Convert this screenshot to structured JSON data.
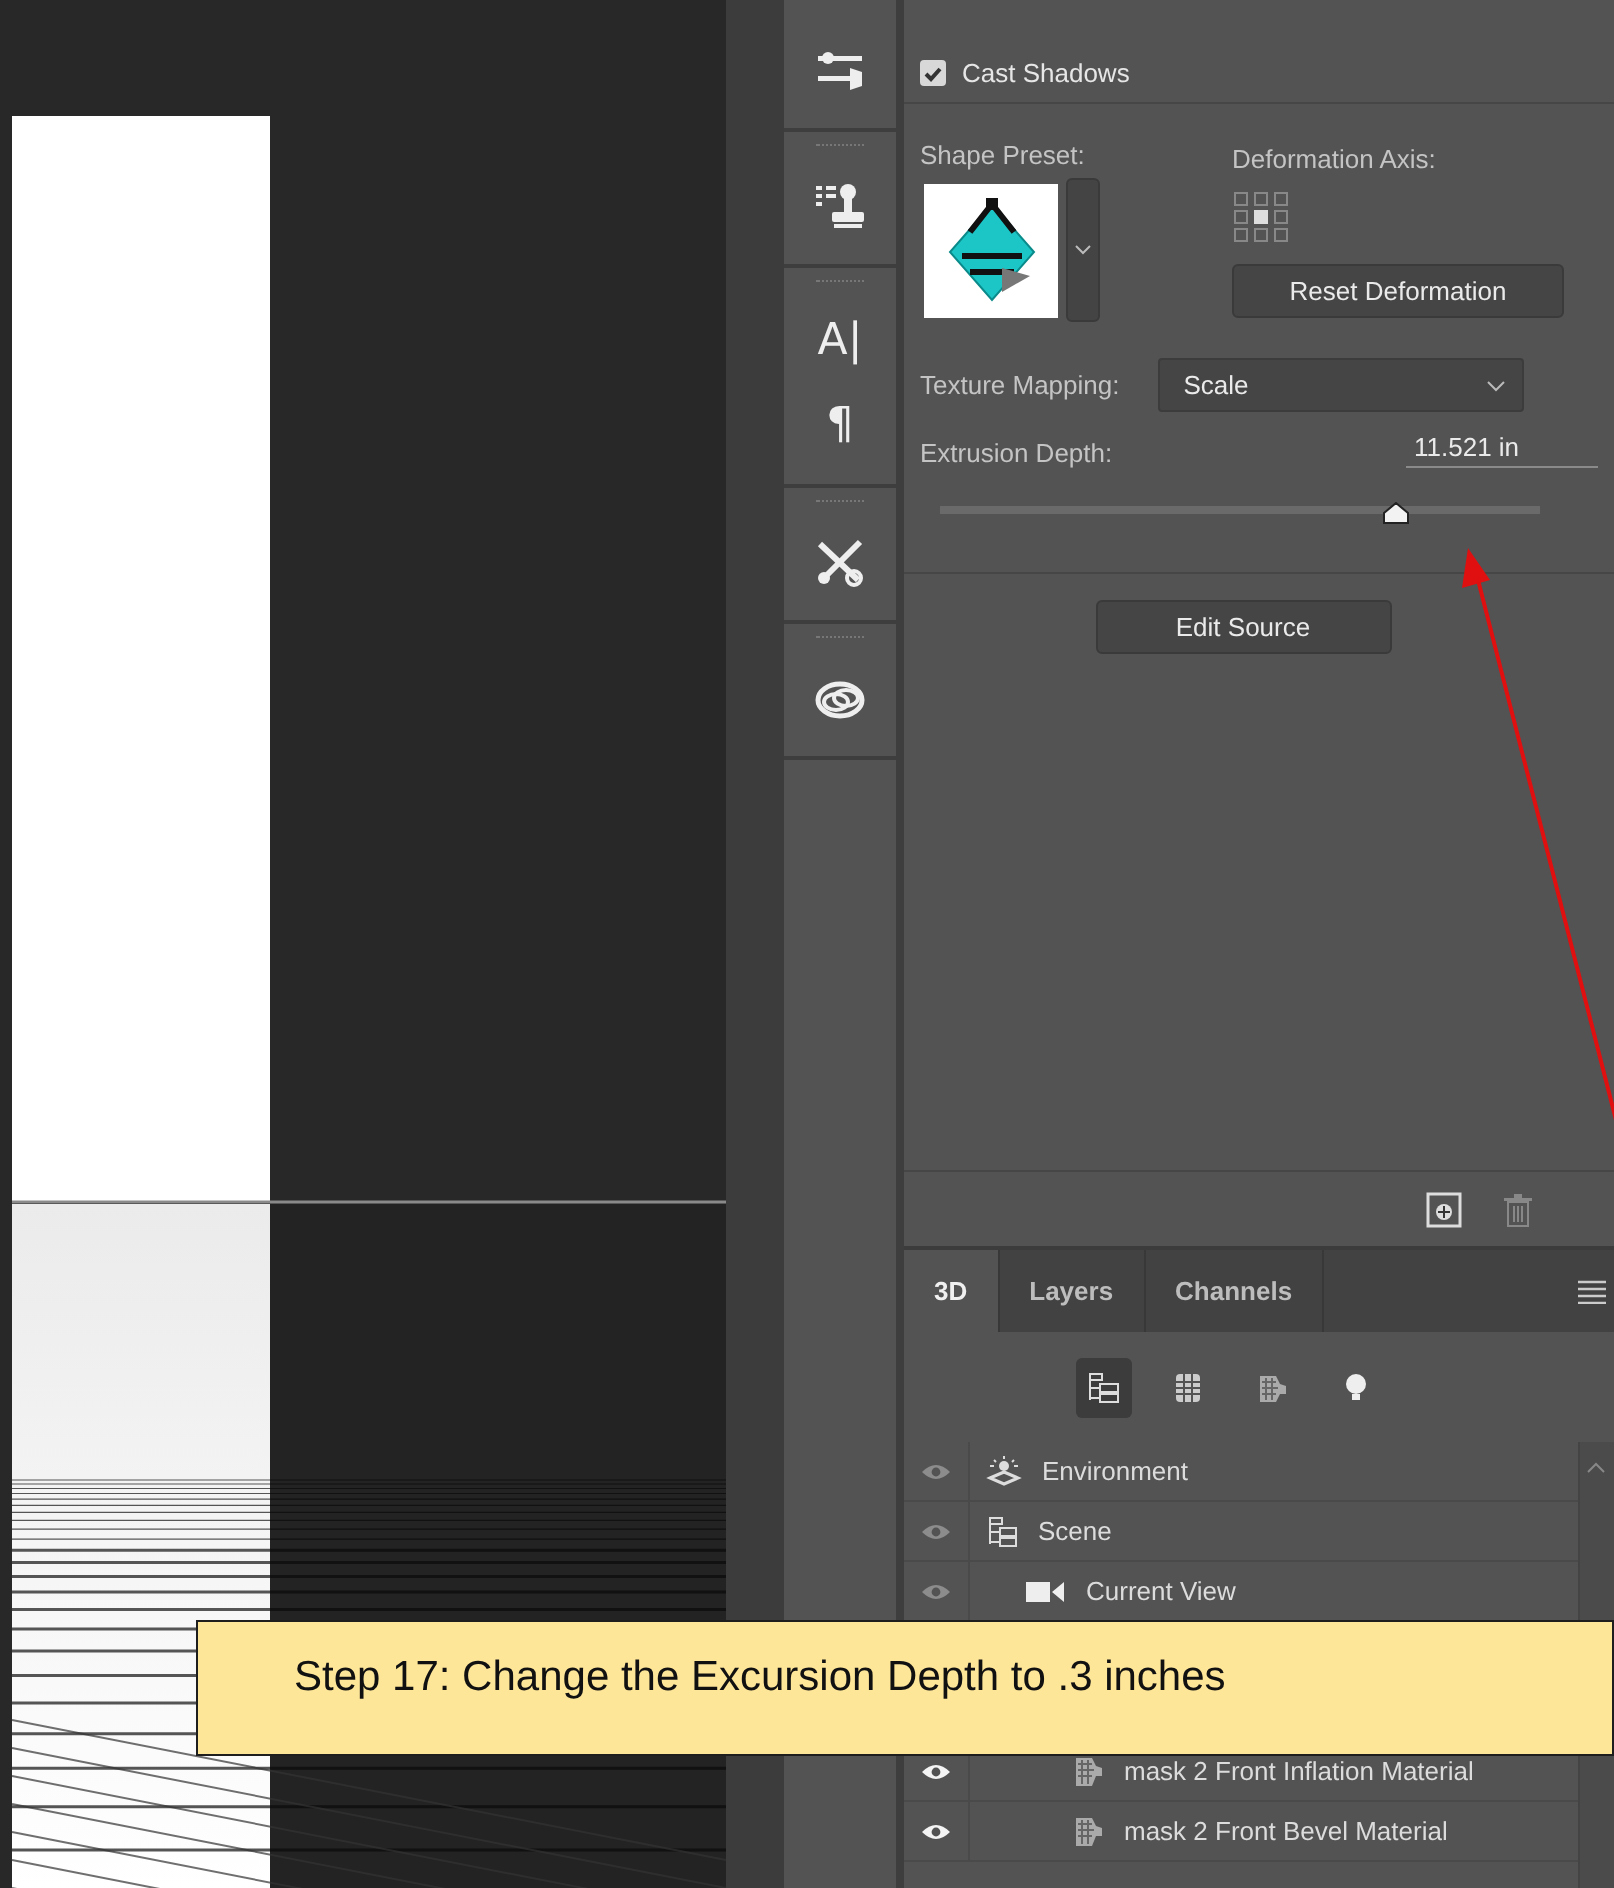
{
  "toolbar": [
    {
      "kind": "sliders"
    },
    {
      "kind": "stamp"
    },
    {
      "kind": "glyph",
      "glyph": "A|"
    },
    {
      "kind": "glyph",
      "glyph": "¶"
    },
    {
      "kind": "tools"
    },
    {
      "kind": "cloud"
    }
  ],
  "properties": {
    "cast_shadows": {
      "label": "Cast Shadows",
      "checked": true
    },
    "shape_preset": {
      "label": "Shape Preset:"
    },
    "deformation_axis": {
      "label": "Deformation Axis:"
    },
    "reset_button": "Reset Deformation",
    "texture_mapping": {
      "label": "Texture Mapping:",
      "value": "Scale"
    },
    "extrusion_depth": {
      "label": "Extrusion Depth:",
      "value": "11.521 in",
      "level": 0.76
    },
    "edit_source_button": "Edit Source"
  },
  "panel_tabs": [
    {
      "label": "3D",
      "selected": true
    },
    {
      "label": "Layers",
      "selected": false
    },
    {
      "label": "Channels",
      "selected": false
    }
  ],
  "filter_buttons": [
    {
      "kind": "scene",
      "selected": true
    },
    {
      "kind": "mesh",
      "selected": false
    },
    {
      "kind": "material",
      "selected": false
    },
    {
      "kind": "light",
      "selected": false
    }
  ],
  "layers": [
    {
      "kind": "environment",
      "name": "Environment",
      "visible": false
    },
    {
      "kind": "scene",
      "name": "Scene",
      "visible": false,
      "children": [
        {
          "kind": "camera",
          "name": "Current View",
          "visible": false
        },
        {
          "kind": "material",
          "name": "mask 2 Front Inflation Material",
          "visible": true
        },
        {
          "kind": "material",
          "name": "mask 2 Front Bevel Material",
          "visible": true
        }
      ]
    }
  ],
  "callout": {
    "text": "Step 17: Change the Excursion Depth to .3 inches"
  }
}
